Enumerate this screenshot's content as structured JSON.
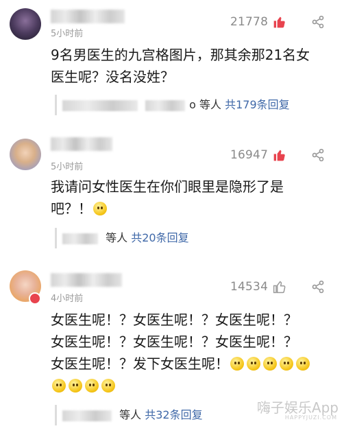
{
  "comments": [
    {
      "time": "5小时前",
      "likes": "21778",
      "liked": true,
      "text_lines": [
        "9名男医生的九宫格图片，那其余那21名女",
        "医生呢？没名没姓？"
      ],
      "reply_tail": "o",
      "reply_people": "等人",
      "reply_count": "共179条回复"
    },
    {
      "time": "5小时前",
      "likes": "16947",
      "liked": true,
      "text_lines": [
        "我请问女性医生在你们眼里是隐形了是",
        "吧？！"
      ],
      "reply_people": "等人",
      "reply_count": "共20条回复"
    },
    {
      "time": "4小时前",
      "likes": "14534",
      "liked": false,
      "text_lines": [
        "女医生呢！？女医生呢！？女医生呢！？",
        "女医生呢！？女医生呢！？女医生呢！？",
        "女医生呢！？发下女医生呢！"
      ],
      "reply_people": "等人",
      "reply_count": "共32条回复"
    }
  ],
  "watermark": {
    "main": "嗨子娱乐App",
    "sub": "HAPPYJUZI.COM"
  },
  "colors": {
    "liked": "#e8434e",
    "unliked": "#9a9a9a",
    "reply_link": "#3f68a8"
  },
  "icons": {
    "like": "thumbs-up-icon",
    "share": "share-icon",
    "emoji": "smile-emoji-icon"
  }
}
